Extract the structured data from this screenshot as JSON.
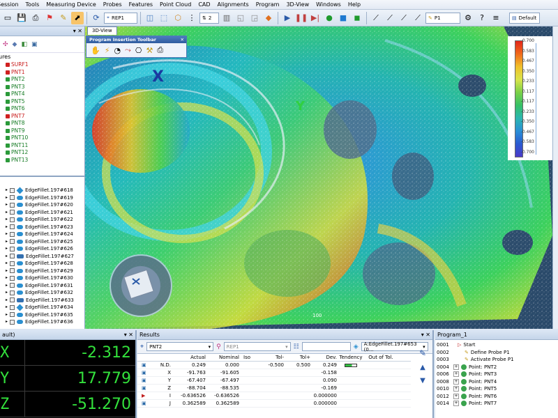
{
  "menu": [
    "Session",
    "Tools",
    "Measuring Device",
    "Probes",
    "Features",
    "Point Cloud",
    "CAD",
    "Alignments",
    "Program",
    "3D-View",
    "Windows",
    "Help"
  ],
  "toolbar": {
    "alignment_select": "REP1",
    "count_select": "2",
    "probe_select": "P1",
    "layout_select": "Default"
  },
  "view": {
    "tab_label": "3D-View",
    "program_toolbar_title": "Program Insertion Toolbar",
    "axis_x": "X",
    "axis_y": "Y",
    "scale_label": "100",
    "legend_values": [
      "0.700",
      "0.583",
      "0.467",
      "0.350",
      "0.233",
      "0.117",
      "-0.117",
      "-0.233",
      "-0.350",
      "-0.467",
      "-0.583",
      "-0.700"
    ],
    "colors": {
      "accent": "#2f5c9f",
      "dro_text": "#33e13c",
      "nok": "#d02020"
    }
  },
  "features": {
    "header": "ures",
    "items": [
      {
        "label": "SURF1",
        "color": "red"
      },
      {
        "label": "PNT1",
        "color": "red"
      },
      {
        "label": "PNT2",
        "color": "green"
      },
      {
        "label": "PNT3",
        "color": "green"
      },
      {
        "label": "PNT4",
        "color": "green"
      },
      {
        "label": "PNT5",
        "color": "green"
      },
      {
        "label": "PNT6",
        "color": "green"
      },
      {
        "label": "PNT7",
        "color": "red"
      },
      {
        "label": "PNT8",
        "color": "green"
      },
      {
        "label": "PNT9",
        "color": "green"
      },
      {
        "label": "PNT10",
        "color": "green"
      },
      {
        "label": "PNT11",
        "color": "green"
      },
      {
        "label": "PNT12",
        "color": "green"
      },
      {
        "label": "PNT13",
        "color": "green"
      }
    ]
  },
  "edges": [
    {
      "label": "EdgeFillet.197#618",
      "icon": "diamond"
    },
    {
      "label": "EdgeFillet.197#619",
      "icon": "surface"
    },
    {
      "label": "EdgeFillet.197#620",
      "icon": "surface"
    },
    {
      "label": "EdgeFillet.197#621",
      "icon": "surface"
    },
    {
      "label": "EdgeFillet.197#622",
      "icon": "surface"
    },
    {
      "label": "EdgeFillet.197#623",
      "icon": "surface"
    },
    {
      "label": "EdgeFillet.197#624",
      "icon": "surface"
    },
    {
      "label": "EdgeFillet.197#625",
      "icon": "surface"
    },
    {
      "label": "EdgeFillet.197#626",
      "icon": "surface"
    },
    {
      "label": "EdgeFillet.197#627",
      "icon": "cylinder"
    },
    {
      "label": "EdgeFillet.197#628",
      "icon": "surface"
    },
    {
      "label": "EdgeFillet.197#629",
      "icon": "surface"
    },
    {
      "label": "EdgeFillet.197#630",
      "icon": "surface"
    },
    {
      "label": "EdgeFillet.197#631",
      "icon": "surface"
    },
    {
      "label": "EdgeFillet.197#632",
      "icon": "surface"
    },
    {
      "label": "EdgeFillet.197#633",
      "icon": "cylinder"
    },
    {
      "label": "EdgeFillet.197#634",
      "icon": "diamond"
    },
    {
      "label": "EdgeFillet.197#635",
      "icon": "surface"
    },
    {
      "label": "EdgeFillet.197#636",
      "icon": "surface"
    }
  ],
  "dro": {
    "title": "ault)",
    "rows": [
      {
        "axis": "X",
        "value": "-2.312"
      },
      {
        "axis": "Y",
        "value": "17.779"
      },
      {
        "axis": "Z",
        "value": "-51.270"
      }
    ]
  },
  "results": {
    "title": "Results",
    "feature_select": "PNT2",
    "alignment_select": "REP1",
    "search_value": "",
    "cad_select": "A:EdgeFillet.197#653 (0...",
    "columns": [
      "",
      "Actual",
      "Nominal",
      "Iso",
      "Tol-",
      "Tol+",
      "Dev.",
      "Tendency",
      "Out of Tol."
    ],
    "rows": [
      {
        "name": "N.D.",
        "actual": "0.249",
        "nominal": "0.000",
        "iso": "",
        "tolm": "-0.500",
        "tolp": "0.500",
        "dev": "0.249",
        "tendency": true,
        "out": ""
      },
      {
        "name": "X",
        "actual": "-91.763",
        "nominal": "-91.605",
        "iso": "",
        "tolm": "",
        "tolp": "",
        "dev": "-0.158",
        "tendency": false,
        "out": ""
      },
      {
        "name": "Y",
        "actual": "-67.407",
        "nominal": "-67.497",
        "iso": "",
        "tolm": "",
        "tolp": "",
        "dev": "0.090",
        "tendency": false,
        "out": ""
      },
      {
        "name": "Z",
        "actual": "-88.704",
        "nominal": "-88.535",
        "iso": "",
        "tolm": "",
        "tolp": "",
        "dev": "-0.169",
        "tendency": false,
        "out": ""
      },
      {
        "name": "I",
        "actual": "-0.636526",
        "nominal": "-0.636526",
        "iso": "",
        "tolm": "",
        "tolp": "",
        "dev": "0.000000",
        "tendency": false,
        "out": ""
      },
      {
        "name": "J",
        "actual": "0.362589",
        "nominal": "0.362589",
        "iso": "",
        "tolm": "",
        "tolp": "",
        "dev": "0.000000",
        "tendency": false,
        "out": ""
      }
    ]
  },
  "program": {
    "title": "Program_1",
    "rows": [
      {
        "num": "0001",
        "label": "Start",
        "indent": 0,
        "type": "start"
      },
      {
        "num": "0002",
        "label": "Define Probe P1",
        "indent": 1,
        "type": "probe"
      },
      {
        "num": "0003",
        "label": "Activate Probe P1",
        "indent": 1,
        "type": "probe"
      },
      {
        "num": "0004",
        "label": "Point: PNT2",
        "indent": 0,
        "type": "point"
      },
      {
        "num": "0006",
        "label": "Point: PNT3",
        "indent": 0,
        "type": "point"
      },
      {
        "num": "0008",
        "label": "Point: PNT4",
        "indent": 0,
        "type": "point"
      },
      {
        "num": "0010",
        "label": "Point: PNT5",
        "indent": 0,
        "type": "point"
      },
      {
        "num": "0012",
        "label": "Point: PNT6",
        "indent": 0,
        "type": "point"
      },
      {
        "num": "0014",
        "label": "Point: PNT7",
        "indent": 0,
        "type": "point"
      }
    ]
  }
}
